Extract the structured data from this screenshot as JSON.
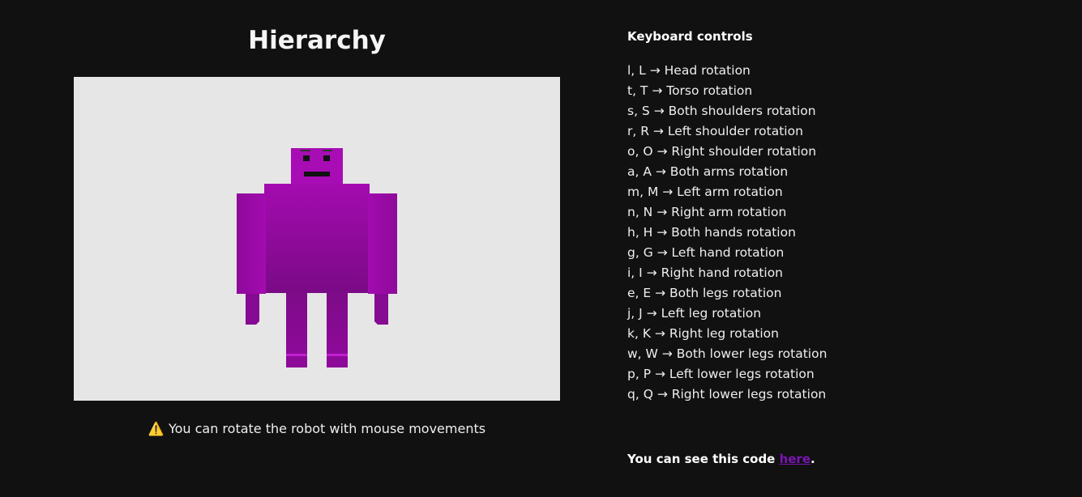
{
  "page": {
    "title": "Hierarchy",
    "hint_icon": "⚠️",
    "hint_text": "You can rotate the robot with mouse movements"
  },
  "viewer": {
    "background": "#e6e6e6",
    "robot_color": "#9b0aa6"
  },
  "controls": {
    "heading": "Keyboard controls",
    "items": [
      "l, L → Head rotation",
      "t, T → Torso rotation",
      "s, S → Both shoulders rotation",
      "r, R → Left shoulder rotation",
      "o, O → Right shoulder rotation",
      "a, A → Both arms rotation",
      "m, M → Left arm rotation",
      "n, N → Right arm rotation",
      "h, H → Both hands rotation",
      "g, G → Left hand rotation",
      "i, I → Right hand rotation",
      "e, E → Both legs rotation",
      "j, J → Left leg rotation",
      "k, K → Right leg rotation",
      "w, W → Both lower legs rotation",
      "p, P → Left lower legs rotation",
      "q, Q → Right lower legs rotation"
    ]
  },
  "footer": {
    "prefix": "You can see this code ",
    "link_text": "here",
    "suffix": "."
  }
}
